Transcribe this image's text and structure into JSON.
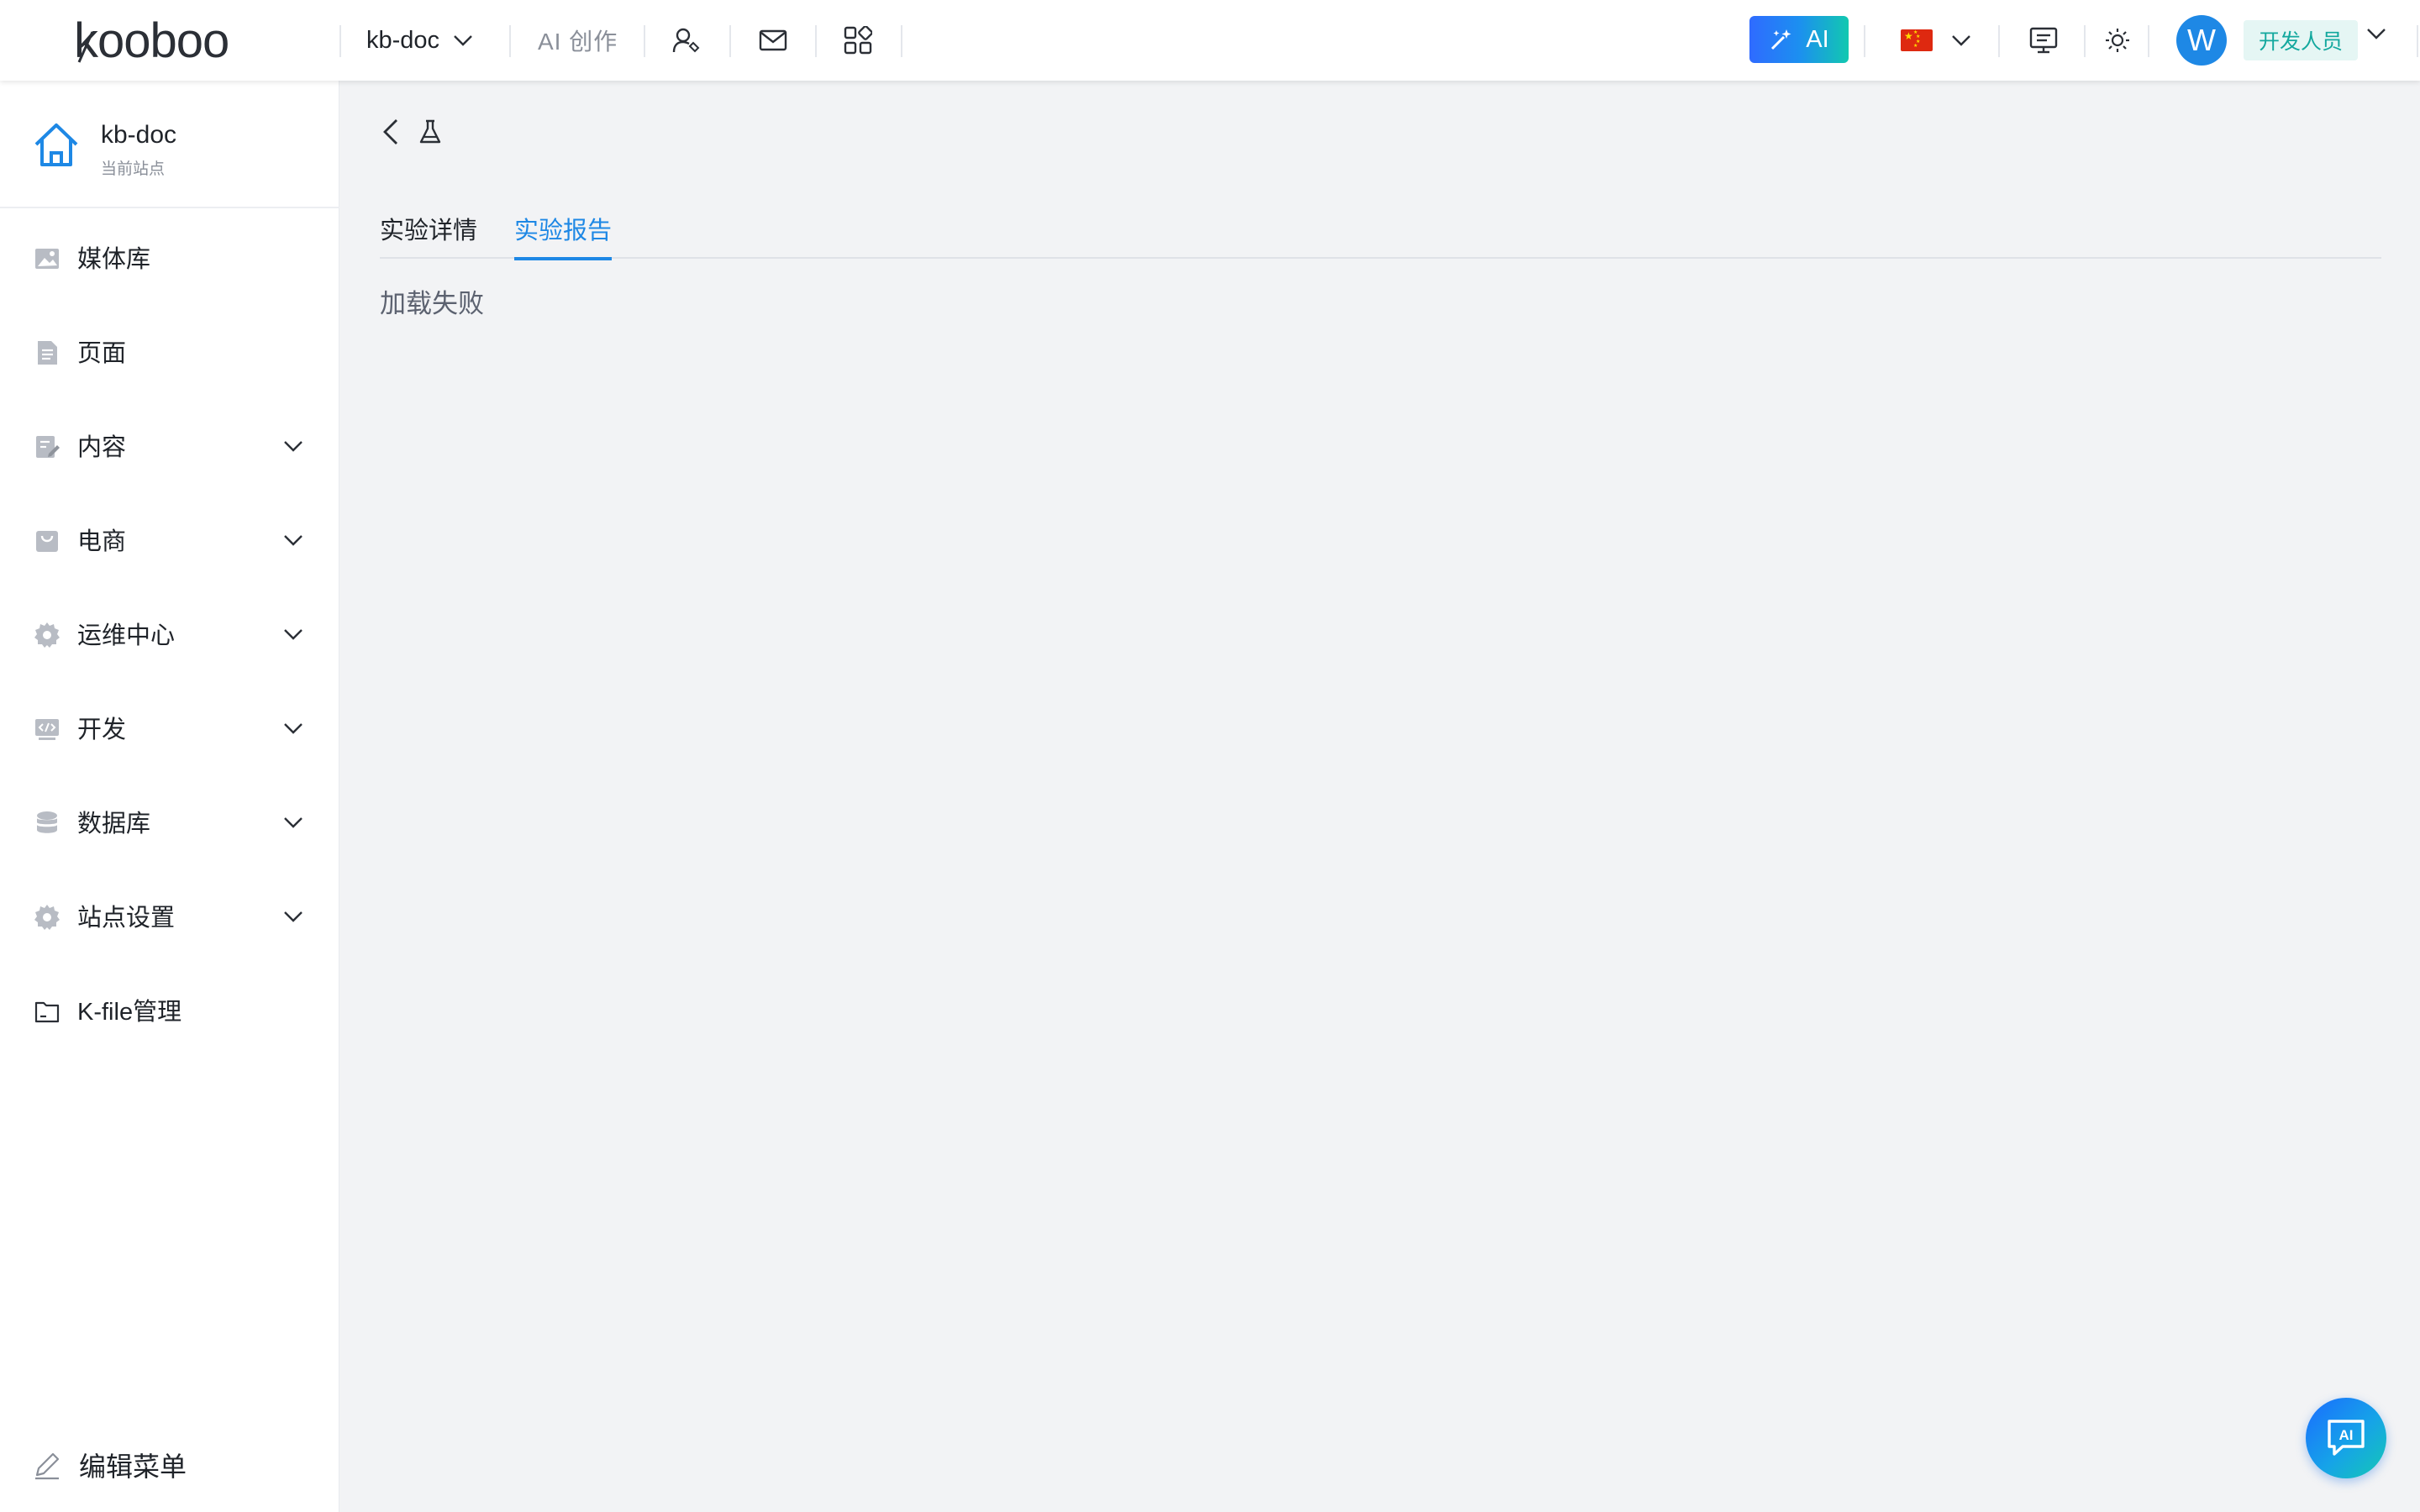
{
  "brand": {
    "logo_text": "kooboo"
  },
  "topbar": {
    "site_name": "kb-doc",
    "ai_create": "AI 创作",
    "ai_button": "AI",
    "avatar_initial": "W",
    "role": "开发人员",
    "language_flag": "cn-flag"
  },
  "sidebar": {
    "site_title": "kb-doc",
    "site_subtitle": "当前站点",
    "items": [
      {
        "label": "媒体库",
        "icon": "image-icon",
        "expandable": false
      },
      {
        "label": "页面",
        "icon": "document-icon",
        "expandable": false
      },
      {
        "label": "内容",
        "icon": "content-edit-icon",
        "expandable": true
      },
      {
        "label": "电商",
        "icon": "shop-icon",
        "expandable": true
      },
      {
        "label": "运维中心",
        "icon": "gear-icon",
        "expandable": true
      },
      {
        "label": "开发",
        "icon": "code-icon",
        "expandable": true
      },
      {
        "label": "数据库",
        "icon": "database-icon",
        "expandable": true
      },
      {
        "label": "站点设置",
        "icon": "settings-icon",
        "expandable": true
      },
      {
        "label": "K-file管理",
        "icon": "folder-icon",
        "expandable": false
      }
    ],
    "edit_menu": "编辑菜单"
  },
  "main": {
    "tabs": [
      {
        "label": "实验详情",
        "active": false
      },
      {
        "label": "实验报告",
        "active": true
      }
    ],
    "status": "加载失败"
  },
  "colors": {
    "accent": "#1e88e5",
    "role_badge_bg": "#e5f6f4",
    "role_badge_text": "#13a89e",
    "page_bg": "#f2f3f5"
  }
}
